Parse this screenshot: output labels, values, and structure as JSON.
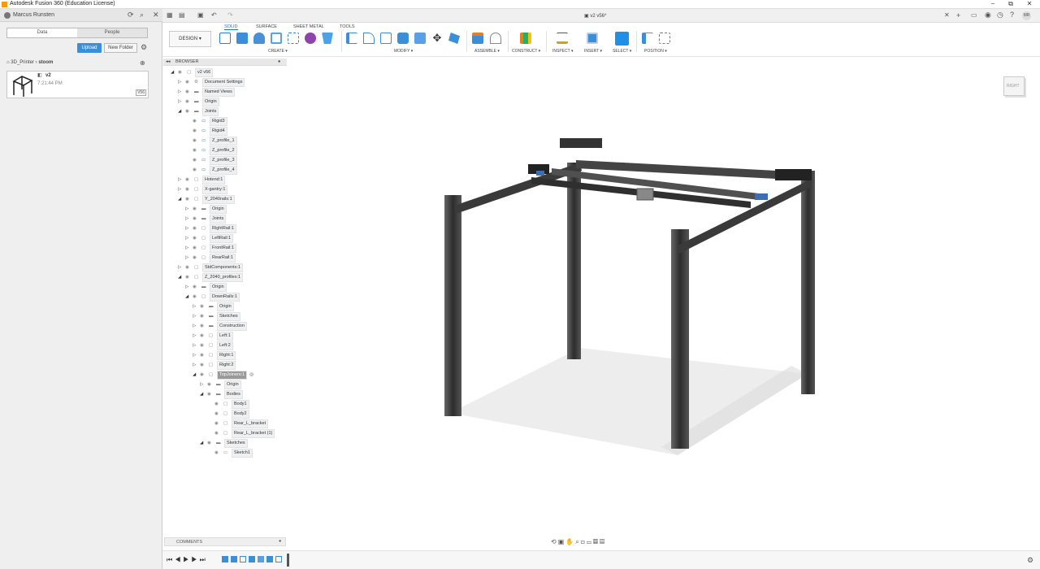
{
  "window": {
    "title": "Autodesk Fusion 360 (Education License)",
    "min": "−",
    "restore": "⧉",
    "close": "✕"
  },
  "user": {
    "name": "Marcus Runsten"
  },
  "data_panel": {
    "tabs": [
      {
        "label": "Data"
      },
      {
        "label": "People"
      }
    ],
    "upload": "Upload",
    "new_folder": "New Folder",
    "breadcrumb": [
      "3D_Printer",
      "stoom"
    ],
    "file": {
      "name": "v2",
      "time": "7:21:44 PM",
      "version": "V56"
    }
  },
  "document": {
    "title": "v2 v56*"
  },
  "toolbar": {
    "workspace": "DESIGN",
    "tabs": [
      {
        "label": "SOLID"
      },
      {
        "label": "SURFACE"
      },
      {
        "label": "SHEET METAL"
      },
      {
        "label": "TOOLS"
      }
    ],
    "groups": [
      {
        "label": "CREATE"
      },
      {
        "label": "MODIFY"
      },
      {
        "label": "ASSEMBLE"
      },
      {
        "label": "CONSTRUCT"
      },
      {
        "label": "INSPECT"
      },
      {
        "label": "INSERT"
      },
      {
        "label": "SELECT"
      },
      {
        "label": "POSITION"
      }
    ],
    "accent": "#1f6fd0"
  },
  "browser": {
    "title": "BROWSER",
    "items": [
      {
        "label": "v2 v56"
      },
      {
        "label": "Document Settings"
      },
      {
        "label": "Named Views"
      },
      {
        "label": "Origin"
      },
      {
        "label": "Joints"
      },
      {
        "label": "Rigid3"
      },
      {
        "label": "Rigid4"
      },
      {
        "label": "Z_profile_1"
      },
      {
        "label": "Z_profile_2"
      },
      {
        "label": "Z_profile_3"
      },
      {
        "label": "Z_profile_4"
      },
      {
        "label": "Hotend:1"
      },
      {
        "label": "X-gantry:1"
      },
      {
        "label": "Y_2040rails:1"
      },
      {
        "label": "Origin"
      },
      {
        "label": "Joints"
      },
      {
        "label": "RightRail:1"
      },
      {
        "label": "LeftRail:1"
      },
      {
        "label": "FrontRail:1"
      },
      {
        "label": "RearRail:1"
      },
      {
        "label": "StdComponents:1"
      },
      {
        "label": "Z_2040_profiles:1"
      },
      {
        "label": "Origin"
      },
      {
        "label": "DownRails:1"
      },
      {
        "label": "Origin"
      },
      {
        "label": "Sketches"
      },
      {
        "label": "Construction"
      },
      {
        "label": "Left:1"
      },
      {
        "label": "Left:2"
      },
      {
        "label": "Right:1"
      },
      {
        "label": "Right:2"
      },
      {
        "label": "TopJoiners:1"
      },
      {
        "label": "Origin"
      },
      {
        "label": "Bodies"
      },
      {
        "label": "Body1"
      },
      {
        "label": "Body2"
      },
      {
        "label": "Rear_L_bracket"
      },
      {
        "label": "Rear_L_bracket (1)"
      },
      {
        "label": "Sketches"
      },
      {
        "label": "Sketch1"
      }
    ]
  },
  "comments": {
    "label": "COMMENTS"
  },
  "viewcube": {
    "label": "RIGHT"
  }
}
